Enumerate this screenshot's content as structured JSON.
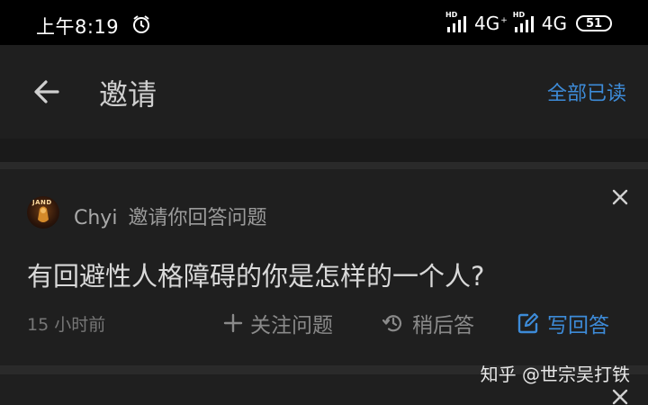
{
  "status_bar": {
    "time": "上午8:19",
    "signal1_label": "HD",
    "net1": "4G",
    "net1_sup": "+",
    "signal2_label": "HD",
    "net2": "4G",
    "battery": "51"
  },
  "app_bar": {
    "title": "邀请",
    "mark_all_read": "全部已读"
  },
  "invite": {
    "avatar_text": "JAND",
    "user": "Chyi",
    "action_text": "邀请你回答问题",
    "question": "有回避性人格障碍的你是怎样的一个人?",
    "time": "15 小时前",
    "follow_label": "关注问题",
    "later_label": "稍后答",
    "write_label": "写回答"
  },
  "watermark": "知乎 @世宗吴打铁",
  "colors": {
    "accent": "#3d8bd8",
    "background": "#1f1f1f",
    "status_bar": "#000000"
  }
}
